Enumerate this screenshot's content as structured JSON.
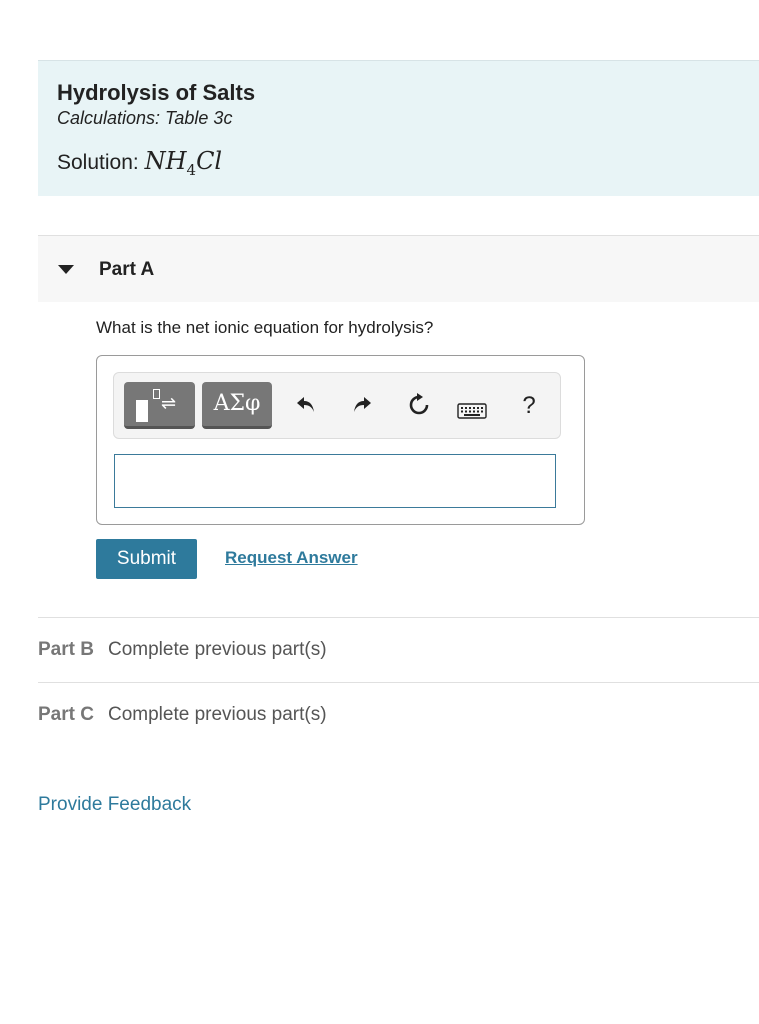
{
  "header": {
    "title": "Hydrolysis of Salts",
    "subtitle": "Calculations: Table 3c",
    "solution_label": "Solution:",
    "formula_main": "NH",
    "formula_sub": "4",
    "formula_tail": "Cl"
  },
  "partA": {
    "label": "Part A",
    "question": "What is the net ionic equation for hydrolysis?",
    "toolbar": {
      "greek_label": "ΑΣφ",
      "templates_arrows": "⇌",
      "help_label": "?"
    },
    "input_value": "",
    "submit_label": "Submit",
    "request_answer_label": "Request Answer"
  },
  "parts": [
    {
      "label": "Part B",
      "status": "Complete previous part(s)"
    },
    {
      "label": "Part C",
      "status": "Complete previous part(s)"
    }
  ],
  "feedback_label": "Provide Feedback",
  "colors": {
    "accent": "#2e7a9c",
    "header_bg": "#e8f4f6"
  }
}
